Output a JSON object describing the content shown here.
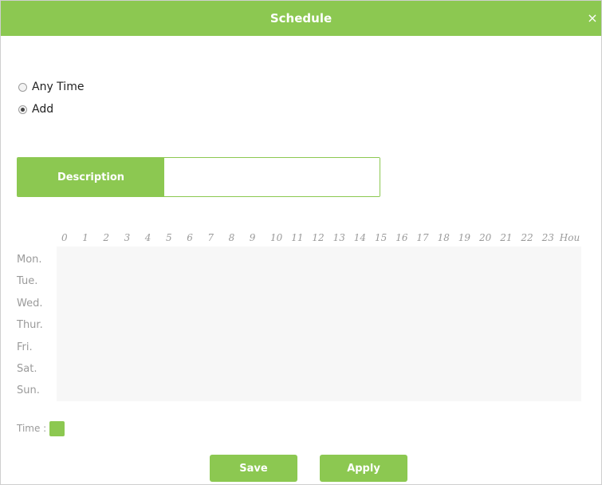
{
  "dialog": {
    "title": "Schedule",
    "close_glyph": "×"
  },
  "options": {
    "any_time_label": "Any Time",
    "add_label": "Add",
    "selected": "Add"
  },
  "description": {
    "label": "Description",
    "value": "",
    "placeholder": ""
  },
  "schedule": {
    "hours": [
      "0",
      "1",
      "2",
      "3",
      "4",
      "5",
      "6",
      "7",
      "8",
      "9",
      "10",
      "11",
      "12",
      "13",
      "14",
      "15",
      "16",
      "17",
      "18",
      "19",
      "20",
      "21",
      "22",
      "23"
    ],
    "hours_unit": "Hou",
    "days": [
      "Mon.",
      "Tue.",
      "Wed.",
      "Thur.",
      "Fri.",
      "Sat.",
      "Sun."
    ]
  },
  "legend": {
    "time_label": "Time :",
    "time_color": "#8cc851"
  },
  "buttons": {
    "save_label": "Save",
    "apply_label": "Apply"
  },
  "colors": {
    "accent": "#8cc851",
    "grid_background": "#f7f7f7"
  }
}
